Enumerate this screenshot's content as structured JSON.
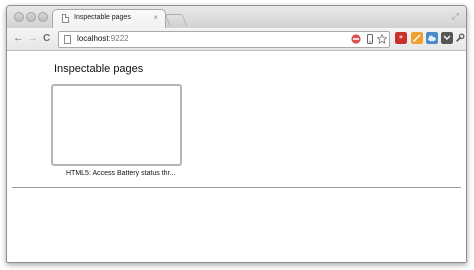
{
  "window": {
    "tab_title": "Inspectable pages",
    "tab_close": "×",
    "fullscreen_glyph": "⤢"
  },
  "toolbar": {
    "back_glyph": "←",
    "forward_glyph": "→",
    "reload_glyph": "C",
    "url_host": "localhost",
    "url_port": ":9222"
  },
  "icons": {
    "page": "page-icon",
    "stop_badge": "stop-icon",
    "mobile": "mobile-icon",
    "star": "star-icon",
    "ext1": "lastpass-icon",
    "ext2": "feed-icon",
    "ext3": "cloud-icon",
    "ext4": "pocket-icon",
    "wrench": "wrench-icon"
  },
  "page": {
    "heading": "Inspectable pages",
    "items": [
      {
        "label": "HTML5: Access Battery status thr..."
      }
    ]
  },
  "colors": {
    "ext_red": "#c9302c",
    "ext_orange": "#f0a030",
    "ext_blue": "#4a8ac8",
    "ext_gray": "#555555",
    "stop_red": "#d9534f"
  }
}
